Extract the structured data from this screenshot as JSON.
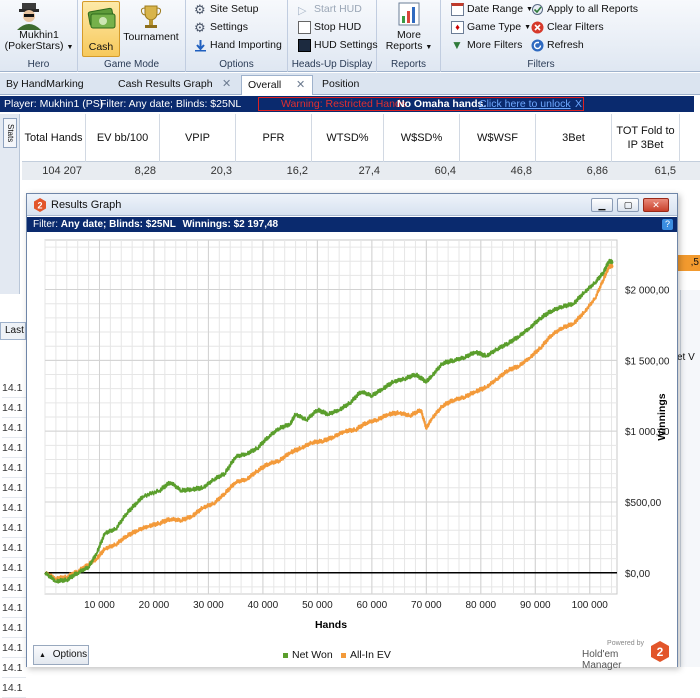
{
  "ribbon": {
    "hero": {
      "name": "Mukhin1 (PokerStars)",
      "label": "Hero"
    },
    "game_mode": {
      "cash": "Cash",
      "tournament": "Tournament",
      "label": "Game Mode"
    },
    "options": {
      "site_setup": "Site Setup",
      "settings": "Settings",
      "hand_importing": "Hand Importing",
      "label": "Options"
    },
    "hud": {
      "start": "Start HUD",
      "stop": "Stop HUD",
      "settings": "HUD Settings",
      "label": "Heads-Up Display"
    },
    "reports": {
      "more": "More Reports",
      "label": "Reports"
    },
    "filters": {
      "date_range": "Date Range",
      "game_type": "Game Type",
      "more": "More Filters",
      "apply_all": "Apply to all Reports",
      "clear": "Clear Filters",
      "refresh": "Refresh",
      "label": "Filters"
    }
  },
  "tabs": [
    {
      "label": "By HandMarking"
    },
    {
      "label": "Cash Results Graph"
    },
    {
      "label": "Overall"
    },
    {
      "label": "Position"
    }
  ],
  "player_bar": {
    "player": "Player: Mukhin1 (PS)",
    "filter": "Filter: Any date; Blinds: $25NL",
    "warning": "Warning: Restricted Hands",
    "no_omaha": "No Omaha hands.",
    "unlock": "Click here to unlock",
    "close": "X"
  },
  "stats": {
    "side_tab": "Stats",
    "headers": [
      "Total Hands",
      "EV bb/100",
      "VPIP",
      "PFR",
      "WTSD%",
      "W$SD%",
      "W$WSF",
      "3Bet",
      "TOT Fold to IP 3Bet"
    ],
    "row": [
      "104 207",
      "8,28",
      "20,3",
      "16,2",
      "27,4",
      "60,4",
      "46,8",
      "6,86",
      "61,5"
    ]
  },
  "background": {
    "last_header": "Last",
    "cells": [
      "14.1",
      "14.1",
      "14.1",
      "14.1",
      "14.1",
      "14.1",
      "14.1",
      "14.1",
      "14.1",
      "14.1",
      "14.1",
      "14.1",
      "14.1",
      "14.1",
      "14.1",
      "14.1"
    ],
    "right_cut": ",5",
    "right_cut2": "et V"
  },
  "graph_window": {
    "title": "Results Graph",
    "filter_prefix": "Filter: ",
    "filter_text": "Any date; Blinds: $25NL",
    "winnings_label": "Winnings: $2 197,48",
    "help": "?",
    "options": "Options",
    "brand_small": "Powered by",
    "brand_name": "Hold'em Manager"
  },
  "chart_data": {
    "type": "line",
    "xlabel": "Hands",
    "ylabel": "Winnings",
    "xlim": [
      0,
      105000
    ],
    "ylim": [
      -150,
      2350
    ],
    "x_ticks": [
      10000,
      20000,
      30000,
      40000,
      50000,
      60000,
      70000,
      80000,
      90000,
      100000
    ],
    "x_tick_labels": [
      "10 000",
      "20 000",
      "30 000",
      "40 000",
      "50 000",
      "60 000",
      "70 000",
      "80 000",
      "90 000",
      "100 000"
    ],
    "y_ticks": [
      0,
      500,
      1000,
      1500,
      2000
    ],
    "y_tick_labels": [
      "$0,00",
      "$500,00",
      "$1 000,00",
      "$1 500,00",
      "$2 000,00"
    ],
    "grid": true,
    "legend_position": "bottom-center",
    "series": [
      {
        "name": "Net Won",
        "color": "#5a9e2c",
        "points": [
          [
            0,
            0
          ],
          [
            2000,
            -60
          ],
          [
            4000,
            -50
          ],
          [
            6000,
            0
          ],
          [
            8000,
            40
          ],
          [
            9500,
            140
          ],
          [
            11000,
            280
          ],
          [
            13000,
            310
          ],
          [
            15000,
            420
          ],
          [
            17000,
            500
          ],
          [
            18000,
            540
          ],
          [
            21000,
            580
          ],
          [
            23000,
            640
          ],
          [
            25000,
            580
          ],
          [
            27000,
            590
          ],
          [
            29000,
            600
          ],
          [
            31000,
            660
          ],
          [
            33000,
            700
          ],
          [
            35000,
            820
          ],
          [
            37000,
            840
          ],
          [
            39000,
            880
          ],
          [
            41000,
            960
          ],
          [
            43000,
            1020
          ],
          [
            45000,
            1050
          ],
          [
            46000,
            1120
          ],
          [
            48000,
            1080
          ],
          [
            50000,
            1150
          ],
          [
            52000,
            1120
          ],
          [
            54000,
            1150
          ],
          [
            56000,
            1200
          ],
          [
            58000,
            1280
          ],
          [
            60000,
            1250
          ],
          [
            62000,
            1300
          ],
          [
            64000,
            1350
          ],
          [
            66000,
            1370
          ],
          [
            68000,
            1400
          ],
          [
            70000,
            1350
          ],
          [
            71000,
            1390
          ],
          [
            73000,
            1480
          ],
          [
            75000,
            1500
          ],
          [
            77000,
            1520
          ],
          [
            79000,
            1560
          ],
          [
            81000,
            1530
          ],
          [
            83000,
            1580
          ],
          [
            85000,
            1620
          ],
          [
            87000,
            1670
          ],
          [
            89000,
            1730
          ],
          [
            91000,
            1800
          ],
          [
            93000,
            1850
          ],
          [
            95000,
            1880
          ],
          [
            97000,
            1900
          ],
          [
            99000,
            1980
          ],
          [
            101000,
            2050
          ],
          [
            102500,
            2120
          ],
          [
            103500,
            2200
          ],
          [
            104207,
            2197
          ]
        ]
      },
      {
        "name": "All-In EV",
        "color": "#f39a3a",
        "points": [
          [
            0,
            0
          ],
          [
            2000,
            -40
          ],
          [
            4000,
            -30
          ],
          [
            6000,
            10
          ],
          [
            8000,
            60
          ],
          [
            9500,
            100
          ],
          [
            11000,
            170
          ],
          [
            13000,
            200
          ],
          [
            15000,
            260
          ],
          [
            17000,
            300
          ],
          [
            19000,
            330
          ],
          [
            21000,
            350
          ],
          [
            23000,
            380
          ],
          [
            25000,
            370
          ],
          [
            27000,
            400
          ],
          [
            29000,
            460
          ],
          [
            31000,
            490
          ],
          [
            33000,
            560
          ],
          [
            35000,
            640
          ],
          [
            37000,
            660
          ],
          [
            39000,
            720
          ],
          [
            41000,
            770
          ],
          [
            43000,
            790
          ],
          [
            45000,
            850
          ],
          [
            47000,
            880
          ],
          [
            49000,
            920
          ],
          [
            51000,
            930
          ],
          [
            53000,
            960
          ],
          [
            55000,
            1000
          ],
          [
            57000,
            1010
          ],
          [
            59000,
            1060
          ],
          [
            61000,
            1080
          ],
          [
            63000,
            1120
          ],
          [
            65000,
            1130
          ],
          [
            67000,
            1110
          ],
          [
            69000,
            1150
          ],
          [
            70000,
            1020
          ],
          [
            71000,
            1090
          ],
          [
            73000,
            1180
          ],
          [
            75000,
            1220
          ],
          [
            77000,
            1240
          ],
          [
            79000,
            1280
          ],
          [
            81000,
            1310
          ],
          [
            83000,
            1370
          ],
          [
            85000,
            1430
          ],
          [
            87000,
            1460
          ],
          [
            89000,
            1520
          ],
          [
            91000,
            1590
          ],
          [
            93000,
            1680
          ],
          [
            95000,
            1730
          ],
          [
            97000,
            1760
          ],
          [
            99000,
            1840
          ],
          [
            101000,
            1940
          ],
          [
            102500,
            2070
          ],
          [
            103500,
            2160
          ],
          [
            104207,
            2170
          ]
        ]
      }
    ]
  }
}
